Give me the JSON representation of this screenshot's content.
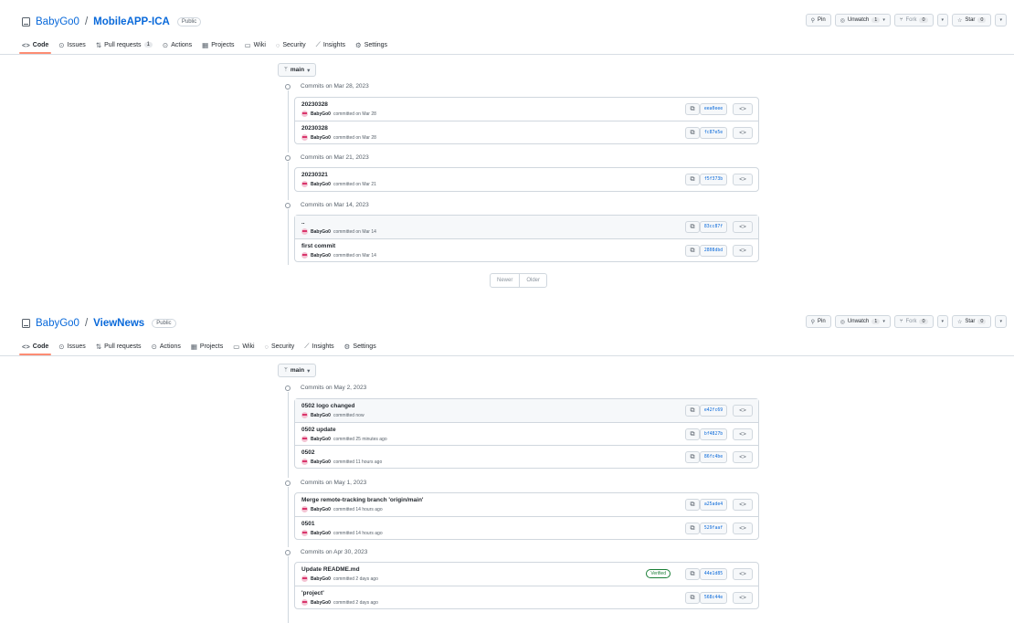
{
  "header_actions": {
    "pin": "Pin",
    "unwatch": "Unwatch",
    "unwatch_count": "1",
    "fork": "Fork",
    "fork_count": "0",
    "star": "Star",
    "star_count": "0"
  },
  "tabs": {
    "code": "Code",
    "issues": "Issues",
    "pull_requests": "Pull requests",
    "pull_requests_count": "1",
    "actions": "Actions",
    "projects": "Projects",
    "wiki": "Wiki",
    "security": "Security",
    "insights": "Insights",
    "settings": "Settings"
  },
  "pager": {
    "newer": "Newer",
    "older": "Older"
  },
  "panels": [
    {
      "owner": "BabyGo0",
      "separator": "/",
      "repo": "MobileAPP-ICA",
      "visibility": "Public",
      "branch": "main",
      "groups": [
        {
          "date": "Commits on Mar 28, 2023",
          "commits": [
            {
              "message": "20230328",
              "author": "BabyGo0",
              "when": "committed on Mar 28",
              "sha": "eea0eee"
            },
            {
              "message": "20230328",
              "author": "BabyGo0",
              "when": "committed on Mar 28",
              "sha": "fc87e5e"
            }
          ]
        },
        {
          "date": "Commits on Mar 21, 2023",
          "commits": [
            {
              "message": "20230321",
              "author": "BabyGo0",
              "when": "committed on Mar 21",
              "sha": "f5f373b"
            }
          ]
        },
        {
          "date": "Commits on Mar 14, 2023",
          "commits": [
            {
              "message": "..",
              "author": "BabyGo0",
              "when": "committed on Mar 14",
              "sha": "83cc87f"
            },
            {
              "message": "first commit",
              "author": "BabyGo0",
              "when": "committed on Mar 14",
              "sha": "2808dbd"
            }
          ]
        }
      ]
    },
    {
      "owner": "BabyGo0",
      "separator": "/",
      "repo": "ViewNews",
      "visibility": "Public",
      "branch": "main",
      "groups": [
        {
          "date": "Commits on May 2, 2023",
          "commits": [
            {
              "message": "0502 logo changed",
              "author": "BabyGo0",
              "when": "committed now",
              "sha": "e42fc69"
            },
            {
              "message": "0502 update",
              "author": "BabyGo0",
              "when": "committed 25 minutes ago",
              "sha": "bf4827b"
            },
            {
              "message": "0502",
              "author": "BabyGo0",
              "when": "committed 11 hours ago",
              "sha": "86fc4be"
            }
          ]
        },
        {
          "date": "Commits on May 1, 2023",
          "commits": [
            {
              "message": "Merge remote-tracking branch 'origin/main'",
              "author": "BabyGo0",
              "when": "committed 14 hours ago",
              "sha": "a25ade4"
            },
            {
              "message": "0501",
              "author": "BabyGo0",
              "when": "committed 14 hours ago",
              "sha": "529faaf"
            }
          ]
        },
        {
          "date": "Commits on Apr 30, 2023",
          "commits": [
            {
              "message": "Update README.md",
              "author": "BabyGo0",
              "when": "committed 2 days ago",
              "sha": "44e1d85",
              "badge": "Verified"
            },
            {
              "message": "'project'",
              "author": "BabyGo0",
              "when": "committed 2 days ago",
              "sha": "568c44e"
            }
          ]
        }
      ]
    }
  ]
}
